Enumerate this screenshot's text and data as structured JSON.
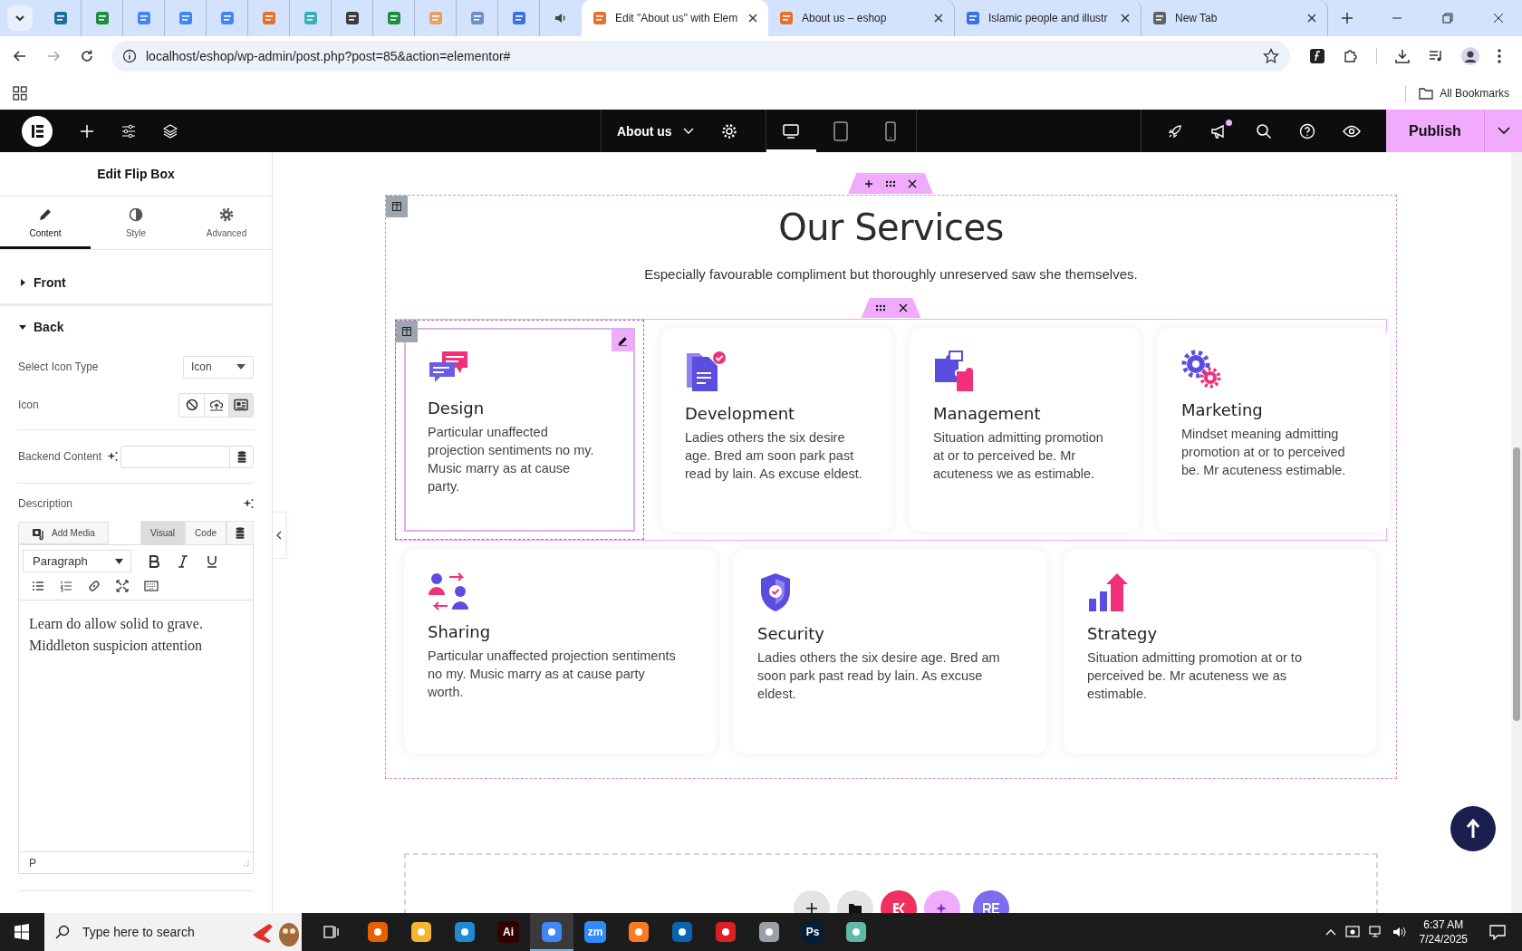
{
  "browser": {
    "tabs": [
      {
        "kind": "pinned",
        "color": "#1b6f9a",
        "selected": false
      },
      {
        "kind": "pinned",
        "color": "#1e8e3e",
        "selected": false
      },
      {
        "kind": "pinned",
        "color": "#4285f4",
        "selected": false
      },
      {
        "kind": "pinned",
        "color": "#4285f4",
        "selected": false
      },
      {
        "kind": "pinned",
        "color": "#4285f4",
        "selected": false
      },
      {
        "kind": "pinned",
        "color": "#e8702a",
        "selected": false
      },
      {
        "kind": "pinned",
        "color": "#3ab0b5",
        "selected": false
      },
      {
        "kind": "pinned",
        "color": "#3c3c3c",
        "selected": false
      },
      {
        "kind": "pinned",
        "color": "#1e8e3e",
        "selected": false
      },
      {
        "kind": "pinned",
        "color": "#e8a060",
        "selected": false
      },
      {
        "kind": "pinned",
        "color": "#6d8fc7",
        "selected": false
      },
      {
        "kind": "pinned",
        "color": "#3a6fe8",
        "selected": false
      },
      {
        "kind": "audio",
        "selected": false
      },
      {
        "kind": "page",
        "title": "Edit \"About us\" with Elem",
        "color": "#e8702a",
        "selected": true
      },
      {
        "kind": "page",
        "title": "About us – eshop",
        "color": "#e8702a",
        "selected": false
      },
      {
        "kind": "page",
        "title": "Islamic people and illustr",
        "color": "#3a6fe8",
        "selected": false
      },
      {
        "kind": "page",
        "title": "New Tab",
        "color": "#5f6368",
        "selected": false
      }
    ],
    "url": "localhost/eshop/wp-admin/post.php?post=85&action=elementor#",
    "bookmarks_label": "All Bookmarks"
  },
  "toolbar": {
    "page_title": "About us",
    "devices": [
      {
        "kind": "desktop",
        "selected": true
      },
      {
        "kind": "tablet",
        "selected": false
      },
      {
        "kind": "mobile",
        "selected": false
      }
    ],
    "notification": true,
    "publish": "Publish"
  },
  "panel": {
    "title": "Edit Flip Box",
    "tabs": [
      {
        "label": "Content",
        "selected": true
      },
      {
        "label": "Style",
        "selected": false
      },
      {
        "label": "Advanced",
        "selected": false
      }
    ],
    "sections": [
      {
        "label": "Front",
        "expanded": false
      },
      {
        "label": "Back",
        "expanded": true
      }
    ],
    "icon_type": {
      "label": "Select Icon Type",
      "value": "Icon"
    },
    "icon": {
      "label": "Icon",
      "options": [
        {
          "kind": "none",
          "selected": false
        },
        {
          "kind": "upload",
          "selected": false
        },
        {
          "kind": "library",
          "selected": true
        }
      ]
    },
    "backend": {
      "label": "Backend Content"
    },
    "description": {
      "label": "Description",
      "add_media": "Add Media",
      "modes": [
        {
          "label": "Visual",
          "selected": true
        },
        {
          "label": "Code",
          "selected": false
        }
      ],
      "format": "Paragraph",
      "text": "Learn do allow solid to grave. Middleton suspicion attention",
      "path": "P"
    }
  },
  "canvas": {
    "title": "Our Services",
    "subtitle": "Especially favourable compliment but thoroughly unreserved saw she themselves.",
    "cards": [
      {
        "title": "Design",
        "text": "Particular unaffected projection sentiments no my. Music marry as at cause party.",
        "selected": true
      },
      {
        "title": "Development",
        "text": "Ladies others the six desire age. Bred am soon park past read by lain. As excuse eldest.",
        "selected": false
      },
      {
        "title": "Management",
        "text": "Situation admitting promotion at or to perceived be. Mr acuteness we as estimable.",
        "selected": false
      },
      {
        "title": "Marketing",
        "text": "Mindset meaning admitting promotion at or to perceived be. Mr acuteness estimable.",
        "selected": false
      },
      {
        "title": "Sharing",
        "text": "Particular unaffected projection sentiments no my. Music marry as at cause party worth.",
        "selected": false
      },
      {
        "title": "Security",
        "text": "Ladies others the six desire age. Bred am soon park past read by lain. As excuse eldest.",
        "selected": false
      },
      {
        "title": "Strategy",
        "text": "Situation admitting promotion at or to perceived be. Mr acuteness we as estimable.",
        "selected": false
      }
    ]
  },
  "taskbar": {
    "search_placeholder": "Type here to search",
    "apps": [
      {
        "color": "#e66000",
        "active": false
      },
      {
        "color": "#f2b632",
        "active": false
      },
      {
        "color": "#1f8ad2",
        "active": false
      },
      {
        "color": "#330000",
        "label": "Ai",
        "active": false
      },
      {
        "color": "#4285f4",
        "active": true
      },
      {
        "color": "#2d8cff",
        "label": "zm",
        "active": false
      },
      {
        "color": "#fb7a24",
        "active": false
      },
      {
        "color": "#0a64ad",
        "active": false
      },
      {
        "color": "#da1f26",
        "active": false
      },
      {
        "color": "#9aa0a6",
        "active": false
      },
      {
        "color": "#001e36",
        "label": "Ps",
        "active": false
      },
      {
        "color": "#5fb8a8",
        "active": false
      }
    ],
    "time": "6:37 AM",
    "date": "7/24/2025"
  }
}
